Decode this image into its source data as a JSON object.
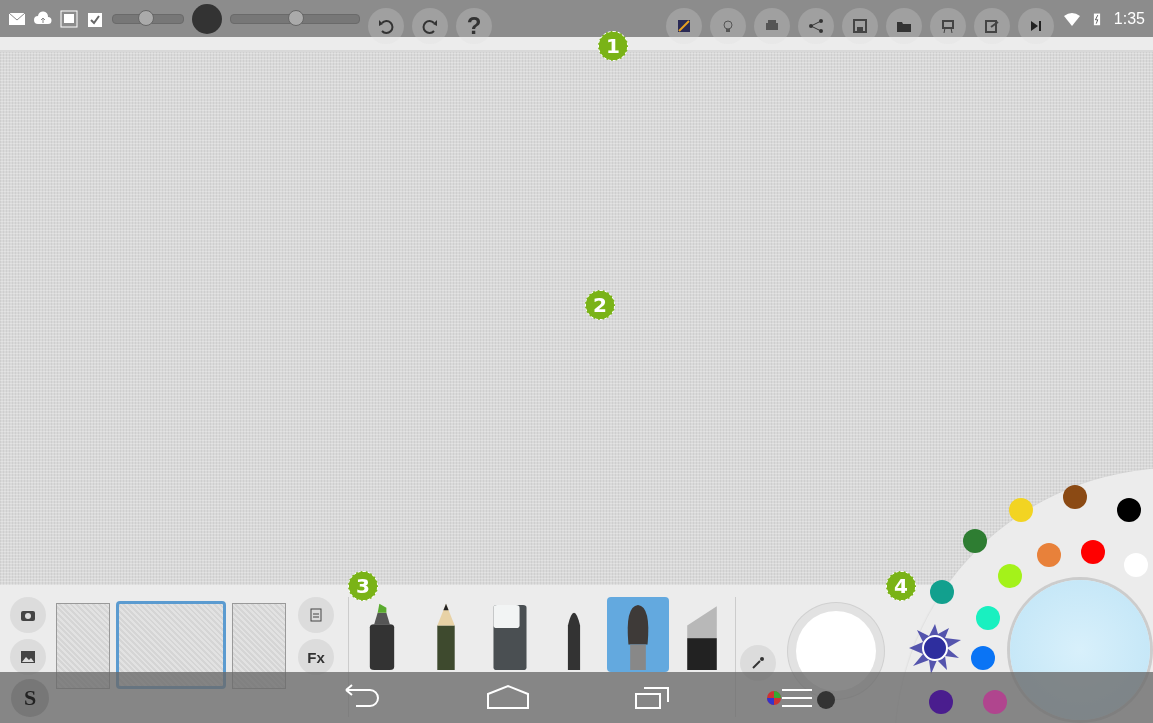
{
  "status_bar": {
    "time": "1:35"
  },
  "toolbar": {
    "size_slider": {
      "level": 0.46
    },
    "opacity_slider": {
      "level": 0.5
    },
    "help_label": "?"
  },
  "callouts": [
    "1",
    "2",
    "3",
    "4"
  ],
  "textures": [
    {
      "selected": false
    },
    {
      "selected": true
    },
    {
      "selected": false
    }
  ],
  "side_buttons": {
    "fx_label": "Fx"
  },
  "tools": [
    {
      "kind": "marker",
      "selected": false
    },
    {
      "kind": "pencil",
      "selected": false
    },
    {
      "kind": "eraser",
      "selected": false
    },
    {
      "kind": "pen",
      "selected": false
    },
    {
      "kind": "brush",
      "selected": true
    },
    {
      "kind": "flat",
      "selected": false
    }
  ],
  "palette": [
    {
      "color": "#f2d422",
      "selected": false
    },
    {
      "color": "#8b4a14",
      "selected": false
    },
    {
      "color": "#000000",
      "selected": false
    },
    {
      "color": "#2e7d32",
      "selected": false
    },
    {
      "color": "#e8813a",
      "selected": false
    },
    {
      "color": "#ff0000",
      "selected": false
    },
    {
      "color": "#ffffff",
      "selected": false
    },
    {
      "color": "#a4f21a",
      "selected": false
    },
    {
      "color": "#12a08e",
      "selected": false
    },
    {
      "color": "#19f0c0",
      "selected": false
    },
    {
      "color": "#0a74f5",
      "selected": false
    },
    {
      "color": "#4a1d8e",
      "selected": false
    },
    {
      "color": "#b0458e",
      "selected": false
    },
    {
      "color": "#2e2e9e",
      "selected": true
    }
  ],
  "nav": {
    "app_label": "S"
  }
}
